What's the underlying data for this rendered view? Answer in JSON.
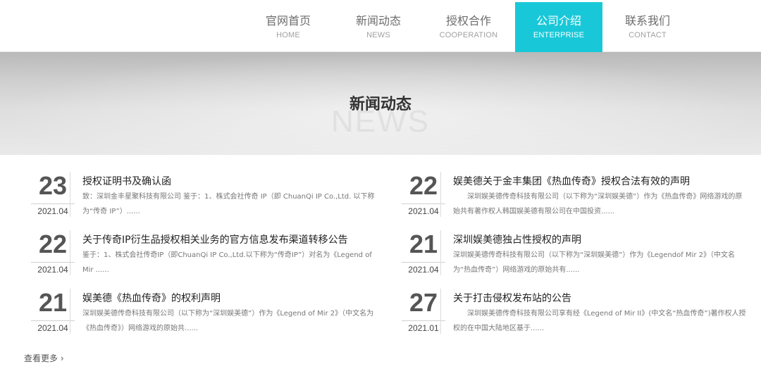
{
  "nav": [
    {
      "zh": "官网首页",
      "en": "HOME",
      "active": false
    },
    {
      "zh": "新闻动态",
      "en": "NEWS",
      "active": false
    },
    {
      "zh": "授权合作",
      "en": "COOPERATION",
      "active": false
    },
    {
      "zh": "公司介绍",
      "en": "ENTERPRISE",
      "active": true
    },
    {
      "zh": "联系我们",
      "en": "CONTACT",
      "active": false
    }
  ],
  "banner": {
    "title": "新闻动态",
    "bg_word": "NEWS"
  },
  "news": [
    {
      "day": "23",
      "ym": "2021.04",
      "title": "授权证明书及确认函",
      "desc": "致：深圳金丰星聚科技有限公司 鉴于：1、株式会社传奇 IP（即 ChuanQi IP Co.,Ltd. 以下称为“传奇 IP”）......"
    },
    {
      "day": "22",
      "ym": "2021.04",
      "title": "娱美德关于金丰集团《热血传奇》授权合法有效的声明",
      "desc": "深圳娱美德传奇科技有限公司（以下称为“深圳娱美德”）作为《热血传奇》网络游戏的原始共有著作权人韩国娱美德有限公司在中国投资......"
    },
    {
      "day": "22",
      "ym": "2021.04",
      "title": "关于传奇IP衍生品授权相关业务的官方信息发布渠道转移公告",
      "desc": "鉴于：1、株式会社传奇IP（即ChuanQi IP Co.,Ltd.以下称为“传奇IP”）对名为《Legend of Mir ......"
    },
    {
      "day": "21",
      "ym": "2021.04",
      "title": "深圳娱美德独占性授权的声明",
      "desc": "深圳娱美德传奇科技有限公司（以下称为“深圳娱美德”）作为《Legendof Mir 2》（中文名为“热血传奇”）网络游戏的原始共有......"
    },
    {
      "day": "21",
      "ym": "2021.04",
      "title": "娱美德《热血传奇》的权利声明",
      "desc": "深圳娱美德传奇科技有限公司（以下称为“深圳娱美德”）作为《Legend of Mir 2》（中文名为《热血传奇》）网络游戏的原始共......"
    },
    {
      "day": "27",
      "ym": "2021.01",
      "title": "关于打击侵权发布站的公告",
      "desc": "深圳娱美德传奇科技有限公司享有经《Legend of Mir II》(中文名“热血传奇”)著作权人授权的在中国大陆地区基于......"
    }
  ],
  "more_label": "查看更多 ›"
}
